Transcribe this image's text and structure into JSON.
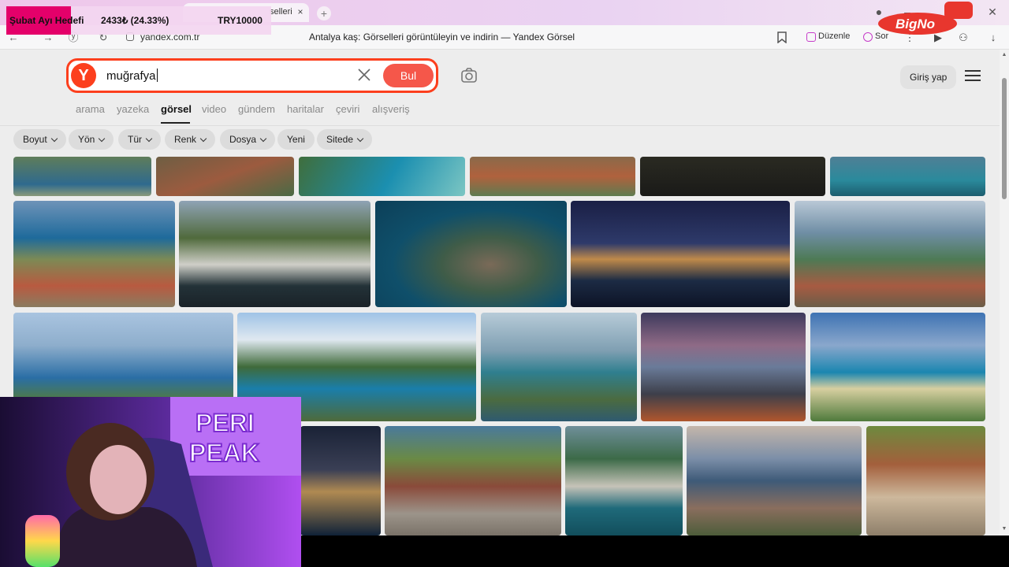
{
  "browser": {
    "tab_title": "selleri",
    "tab_close": "×",
    "new_tab": "+",
    "url": "yandex.com.tr",
    "page_title": "Antalya kaş: Görselleri görüntüleyin ve indirin — Yandex Görsel",
    "edit_label": "Düzenle",
    "ask_label": "Sor"
  },
  "search": {
    "logo": "Y",
    "query": "muğrafya",
    "find_label": "Bul"
  },
  "header": {
    "login_label": "Giriş yap"
  },
  "services": [
    {
      "label": "arama"
    },
    {
      "label": "yazeka"
    },
    {
      "label": "görsel"
    },
    {
      "label": "video"
    },
    {
      "label": "gündem"
    },
    {
      "label": "haritalar"
    },
    {
      "label": "çeviri"
    },
    {
      "label": "alışveriş"
    }
  ],
  "filters": [
    {
      "label": "Boyut"
    },
    {
      "label": "Yön"
    },
    {
      "label": "Tür"
    },
    {
      "label": "Renk"
    },
    {
      "label": "Dosya"
    },
    {
      "label": "Yeni"
    },
    {
      "label": "Sitede"
    }
  ],
  "overlay": {
    "goal_label": "Şubat Ayı Hedefi",
    "goal_progress": "2433₺ (24.33%)",
    "goal_fraction": 0.2433,
    "goal_target": "TRY10000",
    "sponsor_text": "BigNo",
    "neon_line1": "PERI",
    "neon_line2": "PEAK"
  },
  "colors": {
    "accent": "#fc3f1d",
    "find_button": "#f5574a",
    "goal_bar": "#e4006a"
  }
}
